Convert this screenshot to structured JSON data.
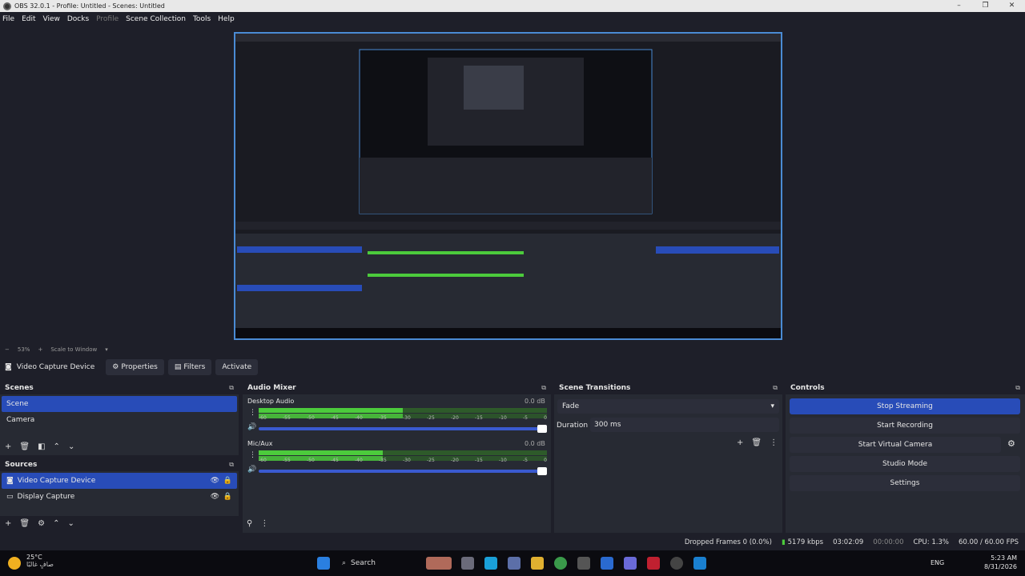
{
  "window": {
    "title": "OBS 32.0.1 - Profile: Untitled - Scenes: Untitled"
  },
  "menu": [
    "File",
    "Edit",
    "View",
    "Docks",
    "Profile",
    "Scene Collection",
    "Tools",
    "Help"
  ],
  "zoom": {
    "level": "53%",
    "mode": "Scale to Window"
  },
  "source_toolbar": {
    "selected": "Video Capture Device",
    "properties": "Properties",
    "filters": "Filters",
    "activate": "Activate"
  },
  "scenes": {
    "title": "Scenes",
    "items": [
      "Scene",
      "Camera"
    ]
  },
  "sources": {
    "title": "Sources",
    "items": [
      "Video Capture Device",
      "Display Capture"
    ]
  },
  "mixer": {
    "title": "Audio Mixer",
    "channels": [
      {
        "name": "Desktop Audio",
        "db": "0.0 dB",
        "level": 0.5
      },
      {
        "name": "Mic/Aux",
        "db": "0.0 dB",
        "level": 0.43
      }
    ],
    "scale": [
      "-60",
      "-55",
      "-50",
      "-45",
      "-40",
      "-35",
      "-30",
      "-25",
      "-20",
      "-15",
      "-10",
      "-5",
      "0"
    ]
  },
  "transitions": {
    "title": "Scene Transitions",
    "selected": "Fade",
    "duration_label": "Duration",
    "duration_value": "300 ms"
  },
  "controls": {
    "title": "Controls",
    "stop_streaming": "Stop Streaming",
    "start_recording": "Start Recording",
    "start_virtual_camera": "Start Virtual Camera",
    "studio_mode": "Studio Mode",
    "settings": "Settings"
  },
  "status": {
    "dropped": "Dropped Frames 0 (0.0%)",
    "bitrate": "5179 kbps",
    "stream_time": "03:02:09",
    "rec_time": "00:00:00",
    "cpu": "CPU: 1.3%",
    "fps": "60.00 / 60.00 FPS"
  },
  "taskbar": {
    "temp": "25°C",
    "weather_text": "صافٍ غالبًا",
    "search": "Search",
    "lang": "ENG",
    "time": "5:23 AM",
    "date": "8/31/2026"
  },
  "colors": {
    "accent": "#284cb8",
    "meter_green": "#4ccb3c",
    "background": "#1e1f29",
    "panel": "#272a33"
  }
}
